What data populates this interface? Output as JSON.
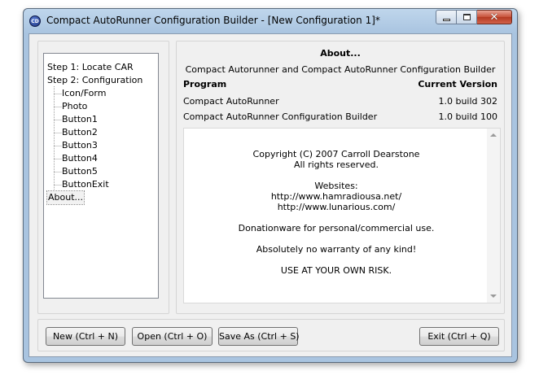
{
  "window": {
    "icon_text": "CD",
    "title": "Compact AutoRunner Configuration Builder - [New Configuration 1]*"
  },
  "tree": {
    "items": [
      {
        "label": "Step 1: Locate CAR",
        "level": 0
      },
      {
        "label": "Step 2: Configuration",
        "level": 0
      },
      {
        "label": "Icon/Form",
        "level": 1
      },
      {
        "label": "Photo",
        "level": 1
      },
      {
        "label": "Button1",
        "level": 1
      },
      {
        "label": "Button2",
        "level": 1
      },
      {
        "label": "Button3",
        "level": 1
      },
      {
        "label": "Button4",
        "level": 1
      },
      {
        "label": "Button5",
        "level": 1
      },
      {
        "label": "ButtonExit",
        "level": 1
      },
      {
        "label": "About...",
        "level": 0,
        "selected": true
      }
    ]
  },
  "about": {
    "title": "About...",
    "subtitle": "Compact Autorunner and Compact AutoRunner Configuration Builder",
    "col_program": "Program",
    "col_version": "Current Version",
    "rows": [
      {
        "program": "Compact AutoRunner",
        "version": "1.0 build 302"
      },
      {
        "program": "Compact AutoRunner Configuration Builder",
        "version": "1.0 build 100"
      }
    ],
    "info": {
      "copyright": "Copyright (C) 2007 Carroll Dearstone",
      "rights": "All rights reserved.",
      "websites_label": "Websites:",
      "site1": "http://www.hamradiousa.net/",
      "site2": "http://www.lunarious.com/",
      "donation": "Donationware for personal/commercial use.",
      "warranty": "Absolutely no warranty of any kind!",
      "risk": "USE AT YOUR OWN RISK."
    }
  },
  "buttons": {
    "new": "New (Ctrl + N)",
    "open": "Open (Ctrl + O)",
    "save_as": "Save As (Ctrl + S)",
    "exit": "Exit (Ctrl + Q)"
  },
  "colors": {
    "frame": "#a9c4e0",
    "close": "#c75038",
    "face": "#f0f0f0"
  }
}
